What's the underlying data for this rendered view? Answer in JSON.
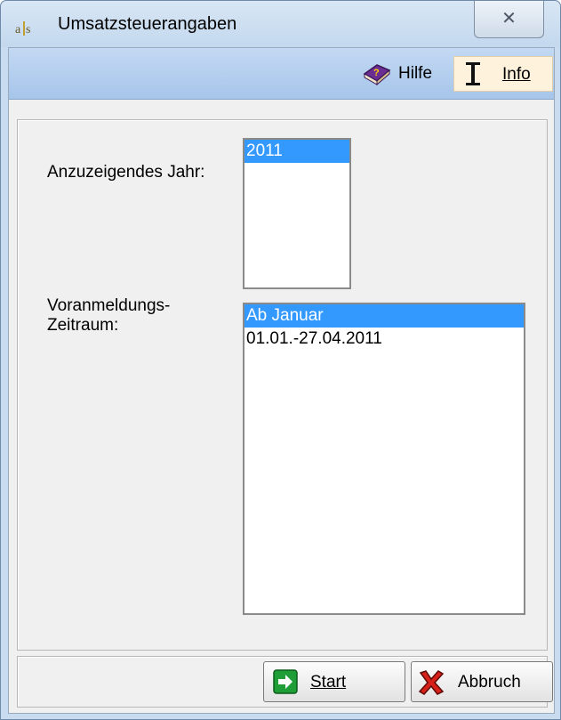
{
  "window": {
    "title": "Umsatzsteuerangaben",
    "close_label": "✕"
  },
  "toolbar": {
    "help_label": "Hilfe",
    "info_label": "Info"
  },
  "form": {
    "year_label": "Anzuzeigendes Jahr:",
    "years": [
      "2011"
    ],
    "selected_year": "2011",
    "period_label_line1": "Voranmeldungs-",
    "period_label_line2": "Zeitraum:",
    "periods": [
      "Ab Januar",
      "01.01.-27.04.2011"
    ],
    "selected_period": "Ab Januar"
  },
  "footer": {
    "start_label": "Start",
    "cancel_label": "Abbruch"
  },
  "icons": {
    "help": "help-book-icon",
    "info": "info-cursor-icon",
    "start": "green-arrow-icon",
    "cancel": "red-x-icon"
  },
  "colors": {
    "selection": "#3399ff",
    "toolbar": "#b5cfee",
    "info_highlight": "#fff2dc"
  }
}
